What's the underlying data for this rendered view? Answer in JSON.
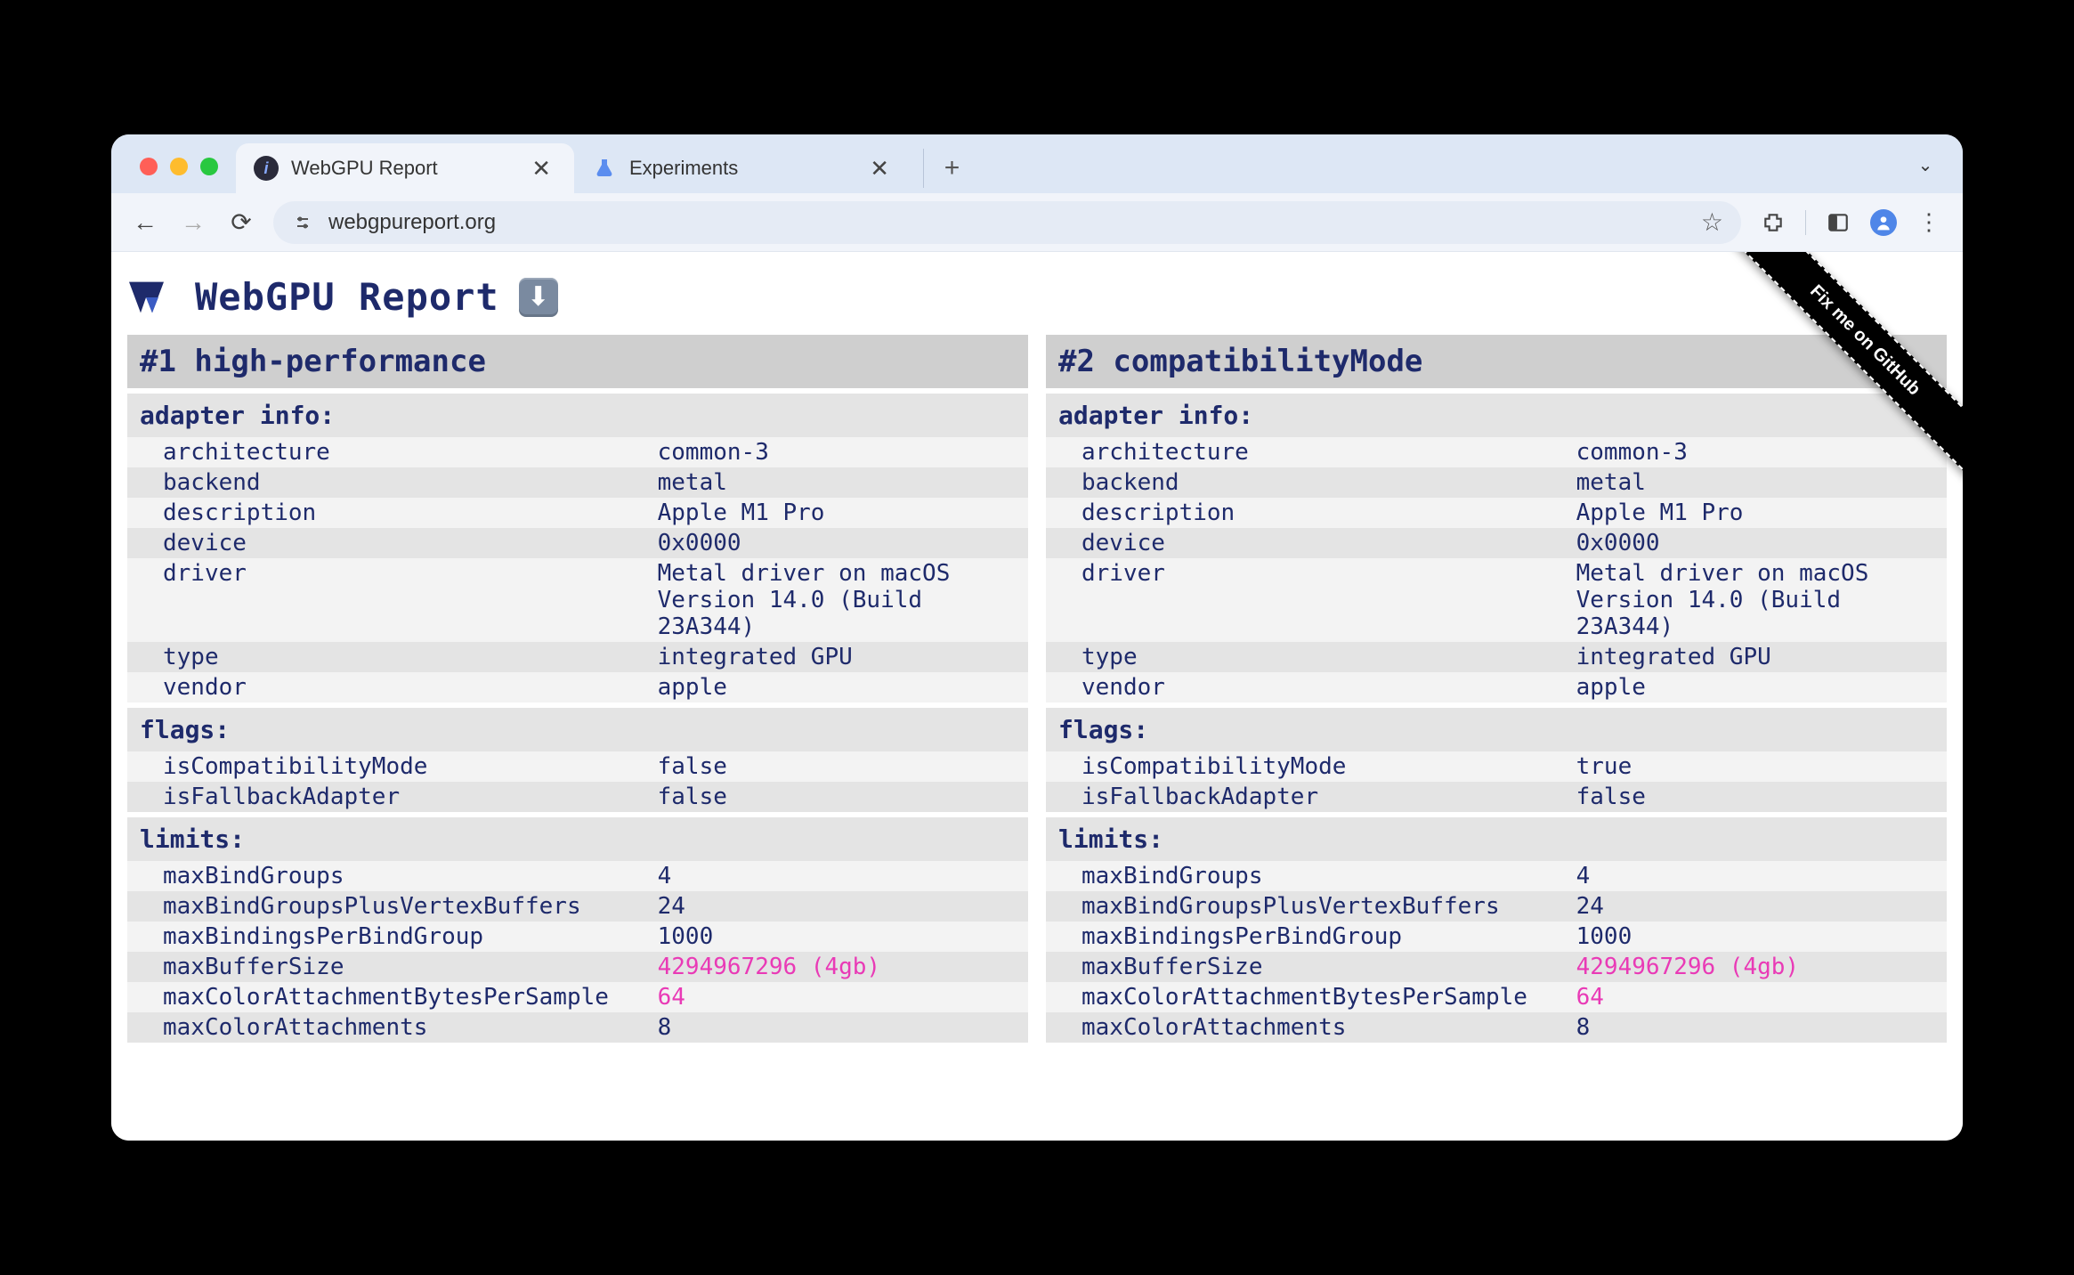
{
  "browser": {
    "tabs": [
      {
        "title": "WebGPU Report",
        "active": true,
        "favicon": "i"
      },
      {
        "title": "Experiments",
        "active": false,
        "favicon": "flask"
      }
    ],
    "url": "webgpureport.org"
  },
  "page": {
    "title": "WebGPU Report",
    "github_ribbon": "Fix me on GitHub"
  },
  "adapters": [
    {
      "heading": "#1 high-performance",
      "adapter_info_label": "adapter info:",
      "adapter_info": [
        {
          "k": "architecture",
          "v": "common-3"
        },
        {
          "k": "backend",
          "v": "metal"
        },
        {
          "k": "description",
          "v": "Apple M1 Pro"
        },
        {
          "k": "device",
          "v": "0x0000"
        },
        {
          "k": "driver",
          "v": "Metal driver on macOS Version 14.0 (Build 23A344)"
        },
        {
          "k": "type",
          "v": "integrated GPU"
        },
        {
          "k": "vendor",
          "v": "apple"
        }
      ],
      "flags_label": "flags:",
      "flags": [
        {
          "k": "isCompatibilityMode",
          "v": "false"
        },
        {
          "k": "isFallbackAdapter",
          "v": "false"
        }
      ],
      "limits_label": "limits:",
      "limits": [
        {
          "k": "maxBindGroups",
          "v": "4"
        },
        {
          "k": "maxBindGroupsPlusVertexBuffers",
          "v": "24"
        },
        {
          "k": "maxBindingsPerBindGroup",
          "v": "1000"
        },
        {
          "k": "maxBufferSize",
          "v": "4294967296 (4gb)",
          "hot": true
        },
        {
          "k": "maxColorAttachmentBytesPerSample",
          "v": "64",
          "hot": true
        },
        {
          "k": "maxColorAttachments",
          "v": "8"
        }
      ]
    },
    {
      "heading": "#2 compatibilityMode",
      "adapter_info_label": "adapter info:",
      "adapter_info": [
        {
          "k": "architecture",
          "v": "common-3"
        },
        {
          "k": "backend",
          "v": "metal"
        },
        {
          "k": "description",
          "v": "Apple M1 Pro"
        },
        {
          "k": "device",
          "v": "0x0000"
        },
        {
          "k": "driver",
          "v": "Metal driver on macOS Version 14.0 (Build 23A344)"
        },
        {
          "k": "type",
          "v": "integrated GPU"
        },
        {
          "k": "vendor",
          "v": "apple"
        }
      ],
      "flags_label": "flags:",
      "flags": [
        {
          "k": "isCompatibilityMode",
          "v": "true"
        },
        {
          "k": "isFallbackAdapter",
          "v": "false"
        }
      ],
      "limits_label": "limits:",
      "limits": [
        {
          "k": "maxBindGroups",
          "v": "4"
        },
        {
          "k": "maxBindGroupsPlusVertexBuffers",
          "v": "24"
        },
        {
          "k": "maxBindingsPerBindGroup",
          "v": "1000"
        },
        {
          "k": "maxBufferSize",
          "v": "4294967296 (4gb)",
          "hot": true
        },
        {
          "k": "maxColorAttachmentBytesPerSample",
          "v": "64",
          "hot": true
        },
        {
          "k": "maxColorAttachments",
          "v": "8"
        }
      ]
    }
  ]
}
